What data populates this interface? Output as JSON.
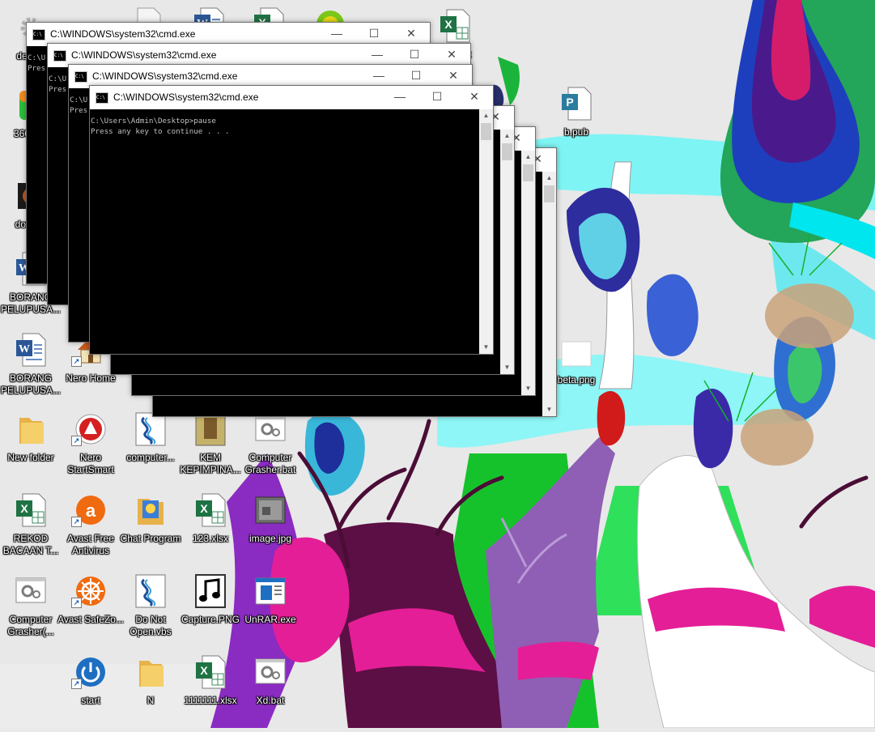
{
  "desktop": {
    "icons": [
      {
        "label": "desk...",
        "type": "gear-file"
      },
      {
        "label": "360安...",
        "type": "app-green"
      },
      {
        "label": "down...",
        "type": "app-dark"
      },
      {
        "label": "BORANG PELUPUSA...",
        "type": "word"
      },
      {
        "label": "BORANG PELUPUSA...",
        "type": "word"
      },
      {
        "label": "Nero Home",
        "type": "house",
        "shortcut": true
      },
      {
        "label": "New folder",
        "type": "folder"
      },
      {
        "label": "Nero StartSmart",
        "type": "nero",
        "shortcut": true
      },
      {
        "label": "computer...",
        "type": "script"
      },
      {
        "label": "KEM KEPIMPINA...",
        "type": "photo"
      },
      {
        "label": "Computer Grasher.bat",
        "type": "bat"
      },
      {
        "label": "REKOD BACAAN T...",
        "type": "excel"
      },
      {
        "label": "Avast Free Antivirus",
        "type": "avast",
        "shortcut": true
      },
      {
        "label": "Chat Program",
        "type": "chat"
      },
      {
        "label": "123.xlsx",
        "type": "excel"
      },
      {
        "label": "image.jpg",
        "type": "image"
      },
      {
        "label": "Computer Grasher(...",
        "type": "bat"
      },
      {
        "label": "Avast SafeZo...",
        "type": "safezone",
        "shortcut": true
      },
      {
        "label": "Do Not Open.vbs",
        "type": "script"
      },
      {
        "label": "Capture.PNG",
        "type": "music"
      },
      {
        "label": "UnRAR.exe",
        "type": "exe"
      },
      {
        "label": "start",
        "type": "power",
        "shortcut": true
      },
      {
        "label": "N",
        "type": "folder"
      },
      {
        "label": "1111111.xlsx",
        "type": "excel"
      },
      {
        "label": "Xd.bat",
        "type": "bat"
      },
      {
        "label": "b.pub",
        "type": "pub"
      },
      {
        "label": "beta.png",
        "type": "blank"
      },
      {
        "label": "...1.xlsx",
        "type": "excel"
      },
      {
        "label": "",
        "type": "blank-file"
      },
      {
        "label": "",
        "type": "word"
      },
      {
        "label": "",
        "type": "excel"
      },
      {
        "label": "",
        "type": "app-ball"
      }
    ]
  },
  "windows": [
    {
      "title": "C:\\WINDOWS\\system32\\cmd.exe",
      "console": "C:\\U\nPres"
    },
    {
      "title": "C:\\WINDOWS\\system32\\cmd.exe",
      "console": "C:\\U\nPres"
    },
    {
      "title": "C:\\WINDOWS\\system32\\cmd.exe",
      "console": "C:\\U\nPres"
    },
    {
      "title": "C:\\WINDOWS\\system32\\cmd.exe",
      "console": "C:\\Users\\Admin\\Desktop>pause\nPress any key to continue . . ."
    },
    {
      "title": "",
      "console": ""
    },
    {
      "title": "",
      "console": ""
    },
    {
      "title": "",
      "console": ""
    }
  ],
  "glyphs": {
    "minimize": "—",
    "maximize": "☐",
    "close": "✕",
    "scroll_up": "▲",
    "scroll_down": "▼",
    "console_icon": "C:\\"
  },
  "colors": {
    "console_bg": "#000000",
    "console_text": "#c0c0c0",
    "titlebar": "#ffffff"
  }
}
